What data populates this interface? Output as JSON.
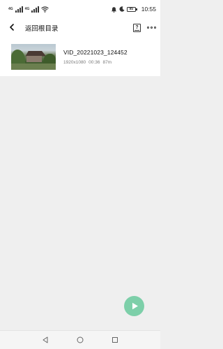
{
  "status_bar": {
    "sim1": "4G",
    "sim2": "4G",
    "battery": "95",
    "time": "10:55"
  },
  "header": {
    "title": "返回根目录",
    "back_icon": "chevron-left-icon",
    "help_icon": "help-book-icon",
    "more_icon": "more-horizontal-icon"
  },
  "files": [
    {
      "name": "VID_20221023_124452",
      "resolution": "1920x1080",
      "duration": "00:36",
      "size": "87m"
    }
  ],
  "fab": {
    "icon": "play-icon",
    "color": "#7dcfa9"
  },
  "nav": {
    "back_icon": "nav-back-icon",
    "home_icon": "nav-home-icon",
    "recents_icon": "nav-recents-icon"
  }
}
